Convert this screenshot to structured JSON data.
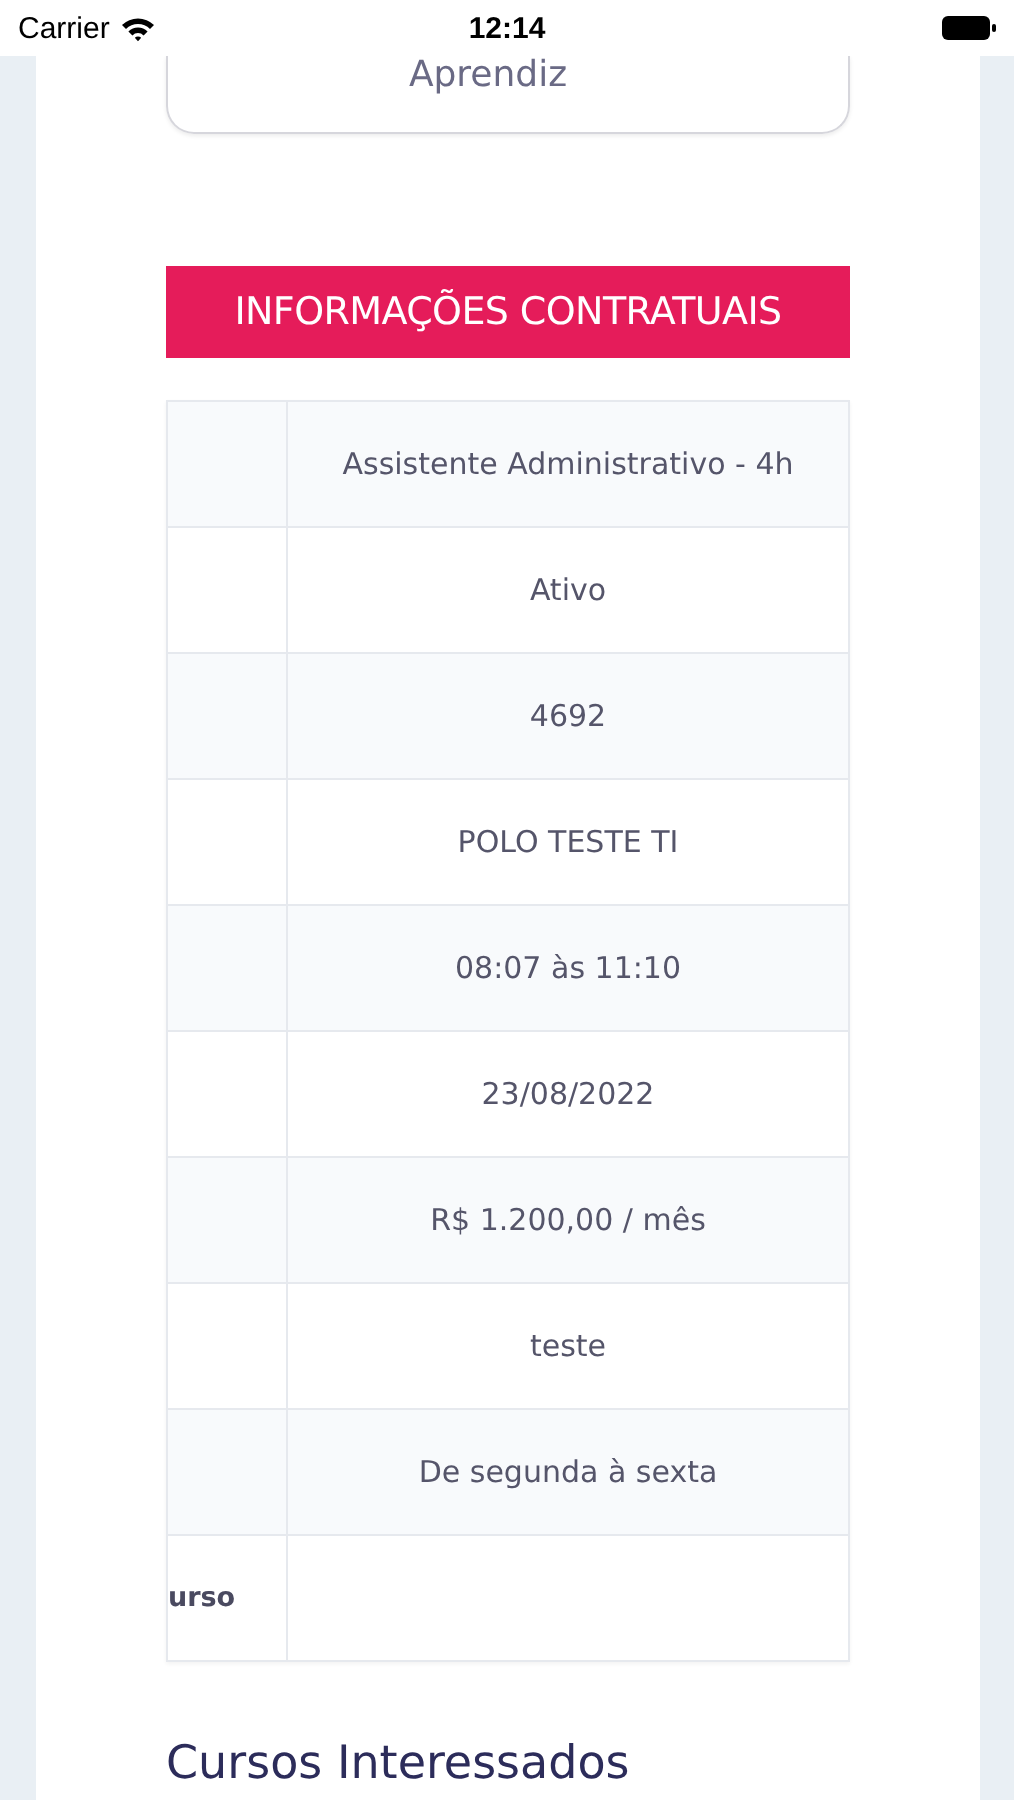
{
  "status_bar": {
    "carrier": "Carrier",
    "time": "12:14"
  },
  "card": {
    "text": "Aprendiz"
  },
  "banner": {
    "title": "INFORMAÇÕES CONTRATUAIS"
  },
  "table": {
    "rows": [
      {
        "value": "Assistente Administrativo - 4h"
      },
      {
        "value": "Ativo"
      },
      {
        "value": "4692"
      },
      {
        "value": "POLO TESTE TI"
      },
      {
        "value": "08:07 às 11:10"
      },
      {
        "value": "23/08/2022"
      },
      {
        "value": "R$ 1.200,00 / mês"
      },
      {
        "value": "teste"
      },
      {
        "value": "De segunda à sexta"
      },
      {
        "label": "urso"
      }
    ]
  },
  "heading": {
    "title": "Cursos Interessados"
  }
}
